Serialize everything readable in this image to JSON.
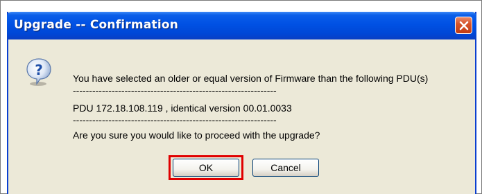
{
  "dialog": {
    "title": "Upgrade -- Confirmation",
    "icon": "question-icon",
    "message_line1": "You have selected an older or equal version of Firmware than the following PDU(s)",
    "separator1": "---------------------------------------------------------------",
    "pdu_line": "PDU 172.18.108.119 , identical version 00.01.0033",
    "separator2": "---------------------------------------------------------------",
    "question": "Are you sure you would like to proceed with the upgrade?",
    "ok_label": "OK",
    "cancel_label": "Cancel"
  },
  "colors": {
    "titlebar": "#0051e4",
    "dialog_bg": "#ece9d8",
    "close_button": "#d6552b",
    "highlight": "#e00000"
  }
}
